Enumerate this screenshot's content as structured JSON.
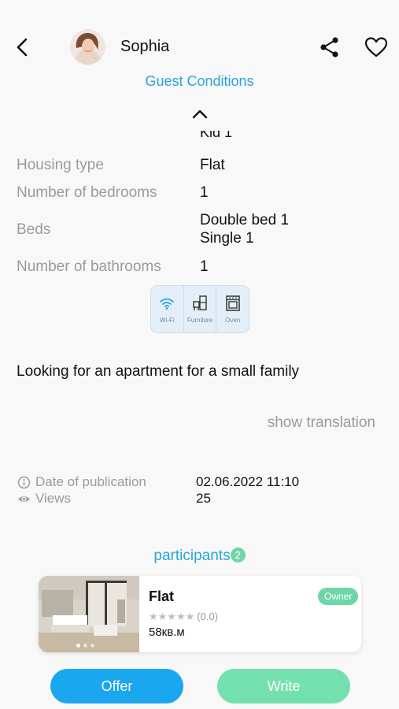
{
  "header": {
    "host_name": "Sophia",
    "section_link": "Guest Conditions"
  },
  "details": {
    "cut_off_value": "Kid 1",
    "rows": [
      {
        "label": "Housing type",
        "value": "Flat"
      },
      {
        "label": "Number of bedrooms",
        "value": "1"
      },
      {
        "label": "Beds",
        "value_lines": [
          "Double bed  1",
          "Single  1"
        ]
      },
      {
        "label": "Number of bathrooms",
        "value": "1"
      }
    ]
  },
  "amenities": [
    {
      "label": "Wi-Fi",
      "icon": "wifi-icon"
    },
    {
      "label": "Furniture",
      "icon": "furniture-icon"
    },
    {
      "label": "Oven",
      "icon": "oven-icon"
    }
  ],
  "description": "Looking for an apartment for a small family",
  "show_translation": "show translation",
  "meta": {
    "publication_label": "Date of publication",
    "publication_value": "02.06.2022  11:10",
    "views_label": "Views",
    "views_value": "25"
  },
  "participants": {
    "label": "participants",
    "count": "2"
  },
  "listing_card": {
    "title": "Flat",
    "badge": "Owner",
    "rating_text": "(0.0)",
    "rating_stars": 0,
    "area": "58кв.м"
  },
  "actions": {
    "offer": "Offer",
    "write": "Write"
  },
  "colors": {
    "accent_blue": "#2aa4dc",
    "offer_button": "#1ba7ef",
    "write_button": "#74e0b0",
    "badge_green": "#6fd6a8"
  }
}
